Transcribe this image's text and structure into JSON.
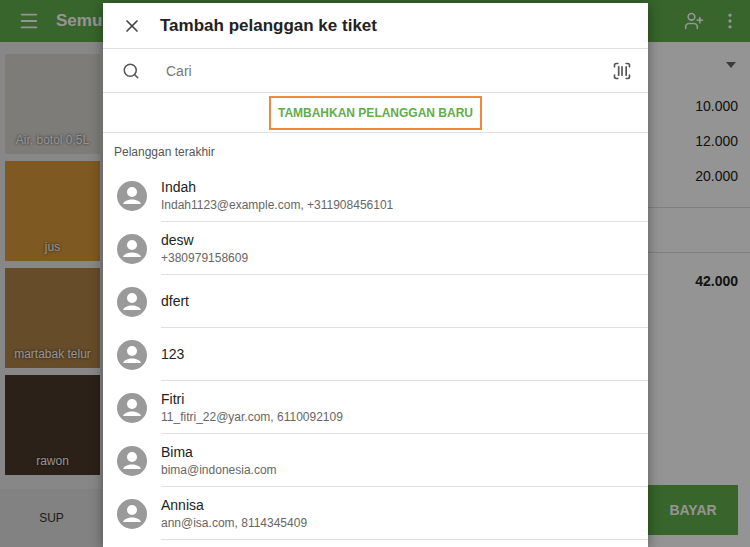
{
  "header": {
    "title": "Semu"
  },
  "catalog": {
    "items": [
      {
        "label": "Air, botol 0,5L",
        "color": "#d9d6cf"
      },
      {
        "label": "jus",
        "color": "#d99a3a"
      },
      {
        "label": "martabak telur",
        "color": "#b08448"
      },
      {
        "label": "rawon",
        "color": "#4b3a2a"
      }
    ],
    "category_tab": "SUP"
  },
  "ticket": {
    "prices": [
      "10.000",
      "12.000",
      "20.000"
    ],
    "total": "42.000",
    "pay_button": "BAYAR"
  },
  "dialog": {
    "title": "Tambah pelanggan ke tiket",
    "search": {
      "placeholder": "Cari"
    },
    "add_button": "TAMBAHKAN PELANGGAN BARU",
    "section_label": "Pelanggan terakhir",
    "customers": [
      {
        "name": "Indah",
        "details": "Indah1123@example.com, +311908456101"
      },
      {
        "name": "desw",
        "details": "+380979158609"
      },
      {
        "name": "dfert"
      },
      {
        "name": "123"
      },
      {
        "name": "Fitri",
        "details": "11_fitri_22@yar.com, 6110092109"
      },
      {
        "name": "Bima",
        "details": "bima@indonesia.com"
      },
      {
        "name": "Annisa",
        "details": "ann@isa.com, 8114345409"
      }
    ]
  }
}
